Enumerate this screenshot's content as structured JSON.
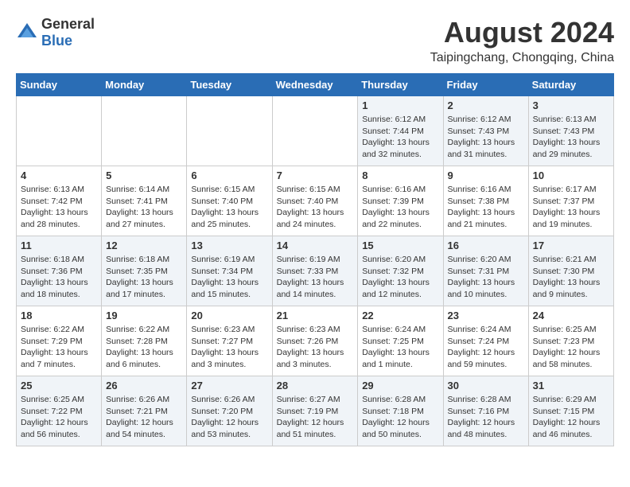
{
  "logo": {
    "general": "General",
    "blue": "Blue"
  },
  "header": {
    "month": "August 2024",
    "location": "Taipingchang, Chongqing, China"
  },
  "weekdays": [
    "Sunday",
    "Monday",
    "Tuesday",
    "Wednesday",
    "Thursday",
    "Friday",
    "Saturday"
  ],
  "weeks": [
    [
      {
        "day": "",
        "info": ""
      },
      {
        "day": "",
        "info": ""
      },
      {
        "day": "",
        "info": ""
      },
      {
        "day": "",
        "info": ""
      },
      {
        "day": "1",
        "info": "Sunrise: 6:12 AM\nSunset: 7:44 PM\nDaylight: 13 hours\nand 32 minutes."
      },
      {
        "day": "2",
        "info": "Sunrise: 6:12 AM\nSunset: 7:43 PM\nDaylight: 13 hours\nand 31 minutes."
      },
      {
        "day": "3",
        "info": "Sunrise: 6:13 AM\nSunset: 7:43 PM\nDaylight: 13 hours\nand 29 minutes."
      }
    ],
    [
      {
        "day": "4",
        "info": "Sunrise: 6:13 AM\nSunset: 7:42 PM\nDaylight: 13 hours\nand 28 minutes."
      },
      {
        "day": "5",
        "info": "Sunrise: 6:14 AM\nSunset: 7:41 PM\nDaylight: 13 hours\nand 27 minutes."
      },
      {
        "day": "6",
        "info": "Sunrise: 6:15 AM\nSunset: 7:40 PM\nDaylight: 13 hours\nand 25 minutes."
      },
      {
        "day": "7",
        "info": "Sunrise: 6:15 AM\nSunset: 7:40 PM\nDaylight: 13 hours\nand 24 minutes."
      },
      {
        "day": "8",
        "info": "Sunrise: 6:16 AM\nSunset: 7:39 PM\nDaylight: 13 hours\nand 22 minutes."
      },
      {
        "day": "9",
        "info": "Sunrise: 6:16 AM\nSunset: 7:38 PM\nDaylight: 13 hours\nand 21 minutes."
      },
      {
        "day": "10",
        "info": "Sunrise: 6:17 AM\nSunset: 7:37 PM\nDaylight: 13 hours\nand 19 minutes."
      }
    ],
    [
      {
        "day": "11",
        "info": "Sunrise: 6:18 AM\nSunset: 7:36 PM\nDaylight: 13 hours\nand 18 minutes."
      },
      {
        "day": "12",
        "info": "Sunrise: 6:18 AM\nSunset: 7:35 PM\nDaylight: 13 hours\nand 17 minutes."
      },
      {
        "day": "13",
        "info": "Sunrise: 6:19 AM\nSunset: 7:34 PM\nDaylight: 13 hours\nand 15 minutes."
      },
      {
        "day": "14",
        "info": "Sunrise: 6:19 AM\nSunset: 7:33 PM\nDaylight: 13 hours\nand 14 minutes."
      },
      {
        "day": "15",
        "info": "Sunrise: 6:20 AM\nSunset: 7:32 PM\nDaylight: 13 hours\nand 12 minutes."
      },
      {
        "day": "16",
        "info": "Sunrise: 6:20 AM\nSunset: 7:31 PM\nDaylight: 13 hours\nand 10 minutes."
      },
      {
        "day": "17",
        "info": "Sunrise: 6:21 AM\nSunset: 7:30 PM\nDaylight: 13 hours\nand 9 minutes."
      }
    ],
    [
      {
        "day": "18",
        "info": "Sunrise: 6:22 AM\nSunset: 7:29 PM\nDaylight: 13 hours\nand 7 minutes."
      },
      {
        "day": "19",
        "info": "Sunrise: 6:22 AM\nSunset: 7:28 PM\nDaylight: 13 hours\nand 6 minutes."
      },
      {
        "day": "20",
        "info": "Sunrise: 6:23 AM\nSunset: 7:27 PM\nDaylight: 13 hours\nand 3 minutes."
      },
      {
        "day": "21",
        "info": "Sunrise: 6:23 AM\nSunset: 7:26 PM\nDaylight: 13 hours\nand 3 minutes."
      },
      {
        "day": "22",
        "info": "Sunrise: 6:24 AM\nSunset: 7:25 PM\nDaylight: 13 hours\nand 1 minute."
      },
      {
        "day": "23",
        "info": "Sunrise: 6:24 AM\nSunset: 7:24 PM\nDaylight: 12 hours\nand 59 minutes."
      },
      {
        "day": "24",
        "info": "Sunrise: 6:25 AM\nSunset: 7:23 PM\nDaylight: 12 hours\nand 58 minutes."
      }
    ],
    [
      {
        "day": "25",
        "info": "Sunrise: 6:25 AM\nSunset: 7:22 PM\nDaylight: 12 hours\nand 56 minutes."
      },
      {
        "day": "26",
        "info": "Sunrise: 6:26 AM\nSunset: 7:21 PM\nDaylight: 12 hours\nand 54 minutes."
      },
      {
        "day": "27",
        "info": "Sunrise: 6:26 AM\nSunset: 7:20 PM\nDaylight: 12 hours\nand 53 minutes."
      },
      {
        "day": "28",
        "info": "Sunrise: 6:27 AM\nSunset: 7:19 PM\nDaylight: 12 hours\nand 51 minutes."
      },
      {
        "day": "29",
        "info": "Sunrise: 6:28 AM\nSunset: 7:18 PM\nDaylight: 12 hours\nand 50 minutes."
      },
      {
        "day": "30",
        "info": "Sunrise: 6:28 AM\nSunset: 7:16 PM\nDaylight: 12 hours\nand 48 minutes."
      },
      {
        "day": "31",
        "info": "Sunrise: 6:29 AM\nSunset: 7:15 PM\nDaylight: 12 hours\nand 46 minutes."
      }
    ]
  ]
}
